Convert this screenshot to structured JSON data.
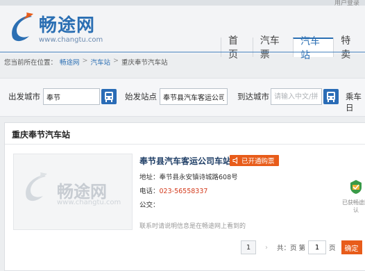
{
  "header": {
    "user_link": "用户登录",
    "brand": "畅途网",
    "url": "www.changtu.com"
  },
  "nav": {
    "items": [
      "首页",
      "汽车票",
      "汽车站",
      "特卖"
    ]
  },
  "breadcrumb": {
    "prefix": "您当前所在位置：",
    "items": [
      "畅途网",
      "汽车站",
      "重庆奉节汽车站"
    ],
    "sep": ">"
  },
  "search": {
    "from_label": "出发城市",
    "from_value": "奉节",
    "station_label": "始发站点",
    "station_value": "奉节县汽车客运公司车站",
    "to_label": "到达城市",
    "to_placeholder": "请输入中文/拼音",
    "date_label": "乘车日"
  },
  "panel": {
    "title": "重庆奉节汽车站",
    "station_name": "奉节县汽车客运公司车站",
    "badge": "已开通购票",
    "address": "地址：奉节县永安镇诗城路608号",
    "phone_label": "电话：",
    "phone": "023-56558337",
    "bus_label": "公交：",
    "note": "联系时请说明信息是在畅途网上看到的",
    "right_badge": "已获畅途网认"
  },
  "pager": {
    "current": "1",
    "total_text": "共：页 第",
    "page_value": "1",
    "page_unit": "页",
    "go": "确定"
  },
  "colors": {
    "brand_blue": "#2b6fb3",
    "accent_orange": "#e85c1a",
    "phone_red": "#d33a1c"
  }
}
